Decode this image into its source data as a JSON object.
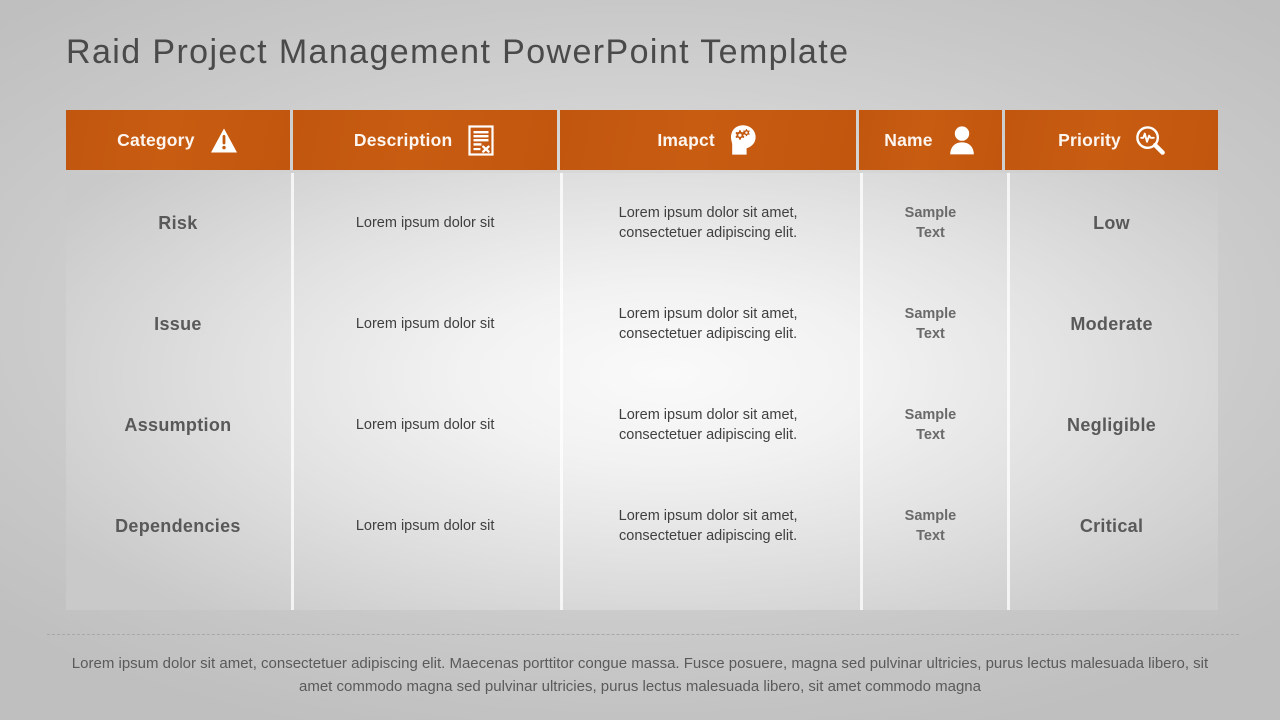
{
  "slide": {
    "title": "Raid Project Management PowerPoint Template",
    "accent_color": "#C65911",
    "background_color": "#CCCCCC",
    "text_color": "#595959"
  },
  "table": {
    "columns": [
      {
        "label": "Category",
        "icon": "warning-triangle-icon"
      },
      {
        "label": "Description",
        "icon": "document-form-icon"
      },
      {
        "label": "Imapct",
        "icon": "head-with-gears-icon"
      },
      {
        "label": "Name",
        "icon": "person-icon"
      },
      {
        "label": "Priority",
        "icon": "magnifier-pulse-icon"
      }
    ],
    "rows": [
      {
        "category": "Risk",
        "description": "Lorem ipsum dolor sit",
        "impact": "Lorem ipsum dolor sit amet, consectetuer adipiscing elit.",
        "name": "Sample Text",
        "priority": "Low"
      },
      {
        "category": "Issue",
        "description": "Lorem ipsum dolor sit",
        "impact": "Lorem ipsum dolor sit amet, consectetuer adipiscing elit.",
        "name": "Sample Text",
        "priority": "Moderate"
      },
      {
        "category": "Assumption",
        "description": "Lorem ipsum dolor sit",
        "impact": "Lorem ipsum dolor sit amet, consectetuer adipiscing elit.",
        "name": "Sample Text",
        "priority": "Negligible"
      },
      {
        "category": "Dependencies",
        "description": "Lorem ipsum dolor sit",
        "impact": "Lorem ipsum dolor sit amet, consectetuer adipiscing elit.",
        "name": "Sample Text",
        "priority": "Critical"
      }
    ]
  },
  "footer": {
    "text": "Lorem ipsum dolor sit amet, consectetuer adipiscing elit. Maecenas porttitor congue massa. Fusce posuere, magna sed pulvinar ultricies, purus lectus malesuada libero, sit amet commodo magna sed pulvinar ultricies, purus lectus malesuada libero, sit amet commodo magna"
  }
}
